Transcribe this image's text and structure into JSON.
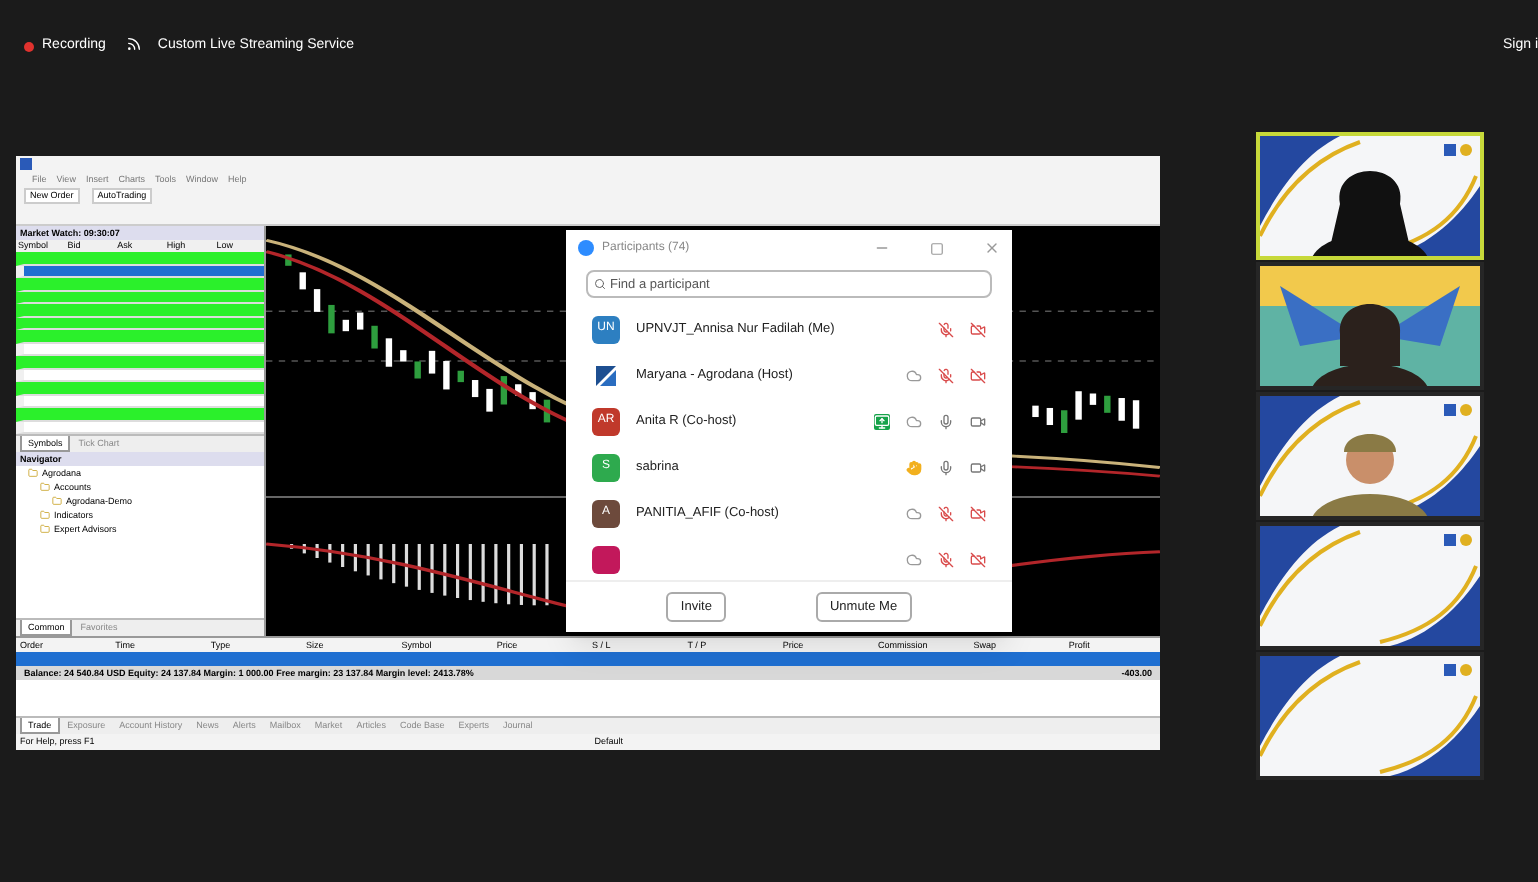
{
  "top_bar": {
    "recording": "Recording",
    "streaming": "Custom Live Streaming Service",
    "sign_in": "Sign i"
  },
  "shared_screen": {
    "menu": [
      "File",
      "View",
      "Insert",
      "Charts",
      "Tools",
      "Window",
      "Help"
    ],
    "toolbar": [
      "New Order",
      "AutoTrading"
    ],
    "market_watch": {
      "title": "Market Watch: 09:30:07",
      "columns": [
        "Symbol",
        "Bid",
        "Ask",
        "High",
        "Low"
      ],
      "rows": [
        {
          "highlighted": true,
          "selected": false
        },
        {
          "highlighted": false,
          "selected": true
        },
        {
          "highlighted": true,
          "selected": false
        },
        {
          "highlighted": true,
          "selected": false
        },
        {
          "highlighted": true,
          "selected": false
        },
        {
          "highlighted": true,
          "selected": false
        },
        {
          "highlighted": true,
          "selected": false
        },
        {
          "highlighted": false,
          "selected": false
        },
        {
          "highlighted": true,
          "selected": false
        },
        {
          "highlighted": false,
          "selected": false
        },
        {
          "highlighted": true,
          "selected": false
        },
        {
          "highlighted": false,
          "selected": false
        },
        {
          "highlighted": true,
          "selected": false
        },
        {
          "highlighted": false,
          "selected": false
        }
      ],
      "tabs": [
        {
          "label": "Symbols",
          "selected": true
        },
        {
          "label": "Tick Chart",
          "selected": false
        }
      ]
    },
    "navigator": {
      "title": "Navigator",
      "tree": [
        {
          "label": "Agrodana",
          "children": [
            {
              "label": "Accounts",
              "children": [
                {
                  "label": "Agrodana-Demo"
                }
              ]
            },
            {
              "label": "Indicators"
            },
            {
              "label": "Expert Advisors"
            }
          ]
        }
      ],
      "tabs": [
        {
          "label": "Common",
          "selected": true
        },
        {
          "label": "Favorites",
          "selected": false
        }
      ]
    },
    "terminal": {
      "columns": [
        "Order",
        "Time",
        "Type",
        "Size",
        "Symbol",
        "Price",
        "S / L",
        "T / P",
        "Price",
        "Commission",
        "Swap",
        "Profit"
      ],
      "balance": "Balance: 24 540.84 USD  Equity: 24 137.84  Margin: 1 000.00  Free margin: 23 137.84  Margin level: 2413.78%",
      "balance_profit": "-403.00",
      "tabs": [
        {
          "label": "Trade",
          "selected": true
        },
        {
          "label": "Exposure",
          "selected": false
        },
        {
          "label": "Account History",
          "selected": false
        },
        {
          "label": "News",
          "selected": false
        },
        {
          "label": "Alerts",
          "selected": false
        },
        {
          "label": "Mailbox",
          "selected": false
        },
        {
          "label": "Market",
          "selected": false
        },
        {
          "label": "Articles",
          "selected": false
        },
        {
          "label": "Code Base",
          "selected": false
        },
        {
          "label": "Experts",
          "selected": false
        },
        {
          "label": "Journal",
          "selected": false
        }
      ],
      "status_help": "For Help, press F1",
      "status_profile": "Default"
    }
  },
  "participants": {
    "title": "Participants (74)",
    "search": {
      "placeholder": "Find a participant"
    },
    "rows": [
      {
        "avatar": {
          "kind": "initials",
          "text": "UN",
          "color": "#2d7fc1"
        },
        "name": "UPNVJT_Annisa Nur Fadilah (Me)",
        "icons": [
          {
            "kind": "mic_off"
          },
          {
            "kind": "video_off"
          }
        ]
      },
      {
        "avatar": {
          "kind": "logo"
        },
        "name": "Maryana - Agrodana (Host)",
        "icons": [
          {
            "kind": "cloud"
          },
          {
            "kind": "mic_off"
          },
          {
            "kind": "video_off"
          }
        ]
      },
      {
        "avatar": {
          "kind": "initials",
          "text": "AR",
          "color": "#c0392b"
        },
        "name": "Anita R (Co-host)",
        "icons": [
          {
            "kind": "sharing"
          },
          {
            "kind": "cloud"
          },
          {
            "kind": "mic"
          },
          {
            "kind": "video"
          }
        ]
      },
      {
        "avatar": {
          "kind": "initials",
          "text": "S",
          "color": "#2eaa4e"
        },
        "name": "sabrina",
        "icons": [
          {
            "kind": "hand"
          },
          {
            "kind": "mic"
          },
          {
            "kind": "video"
          }
        ]
      },
      {
        "avatar": {
          "kind": "initials",
          "text": "A",
          "color": "#6d4a3c"
        },
        "name": "PANITIA_AFIF (Co-host)",
        "icons": [
          {
            "kind": "cloud"
          },
          {
            "kind": "mic_off"
          },
          {
            "kind": "video_off"
          }
        ]
      },
      {
        "avatar": {
          "kind": "blank",
          "color": "#c2185b"
        },
        "icons": [
          {
            "kind": "cloud"
          },
          {
            "kind": "mic_off"
          },
          {
            "kind": "video_off"
          }
        ]
      }
    ],
    "buttons": [
      "Invite",
      "Unmute Me"
    ]
  },
  "videos": [
    {
      "kind": "person",
      "speaking": true
    },
    {
      "kind": "banner_person",
      "speaking": false
    },
    {
      "kind": "person",
      "speaking": false
    },
    {
      "kind": "empty",
      "speaking": false
    },
    {
      "kind": "empty",
      "speaking": false
    }
  ]
}
